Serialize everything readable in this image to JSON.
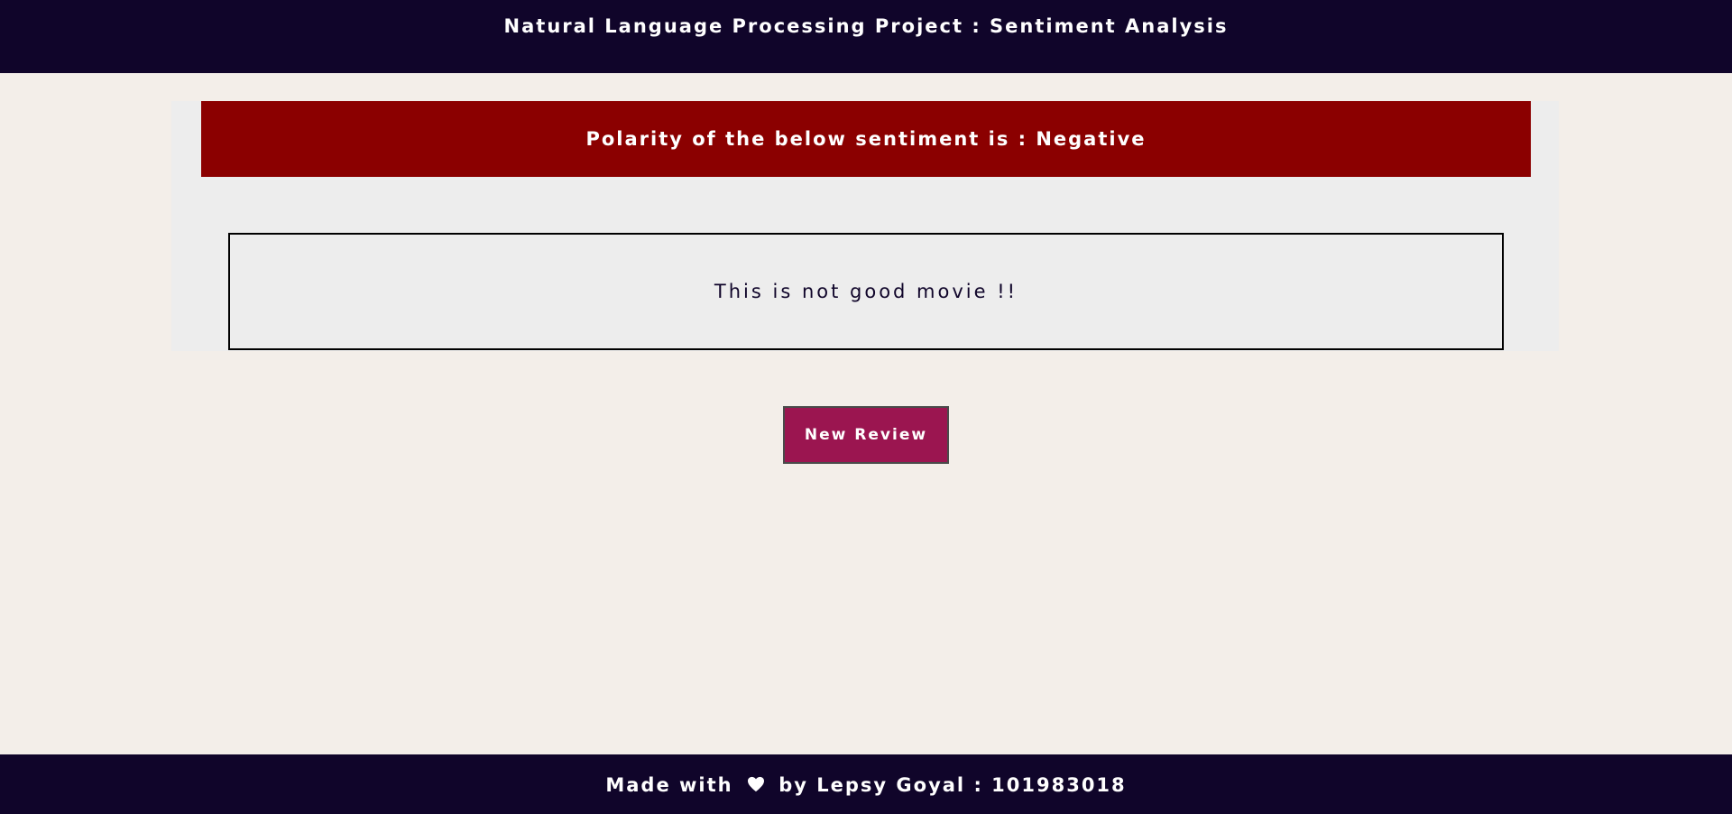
{
  "header": {
    "title": "Natural Language Processing Project : Sentiment Analysis"
  },
  "result": {
    "banner_text": "Polarity of the below sentiment is : Negative",
    "review_text": "This is not good movie !!"
  },
  "actions": {
    "new_review_label": "New Review"
  },
  "footer": {
    "prefix": "Made with",
    "icon": "heart-icon",
    "suffix": "by Lepsy Goyal : 101983018"
  },
  "colors": {
    "header_bg": "#10052a",
    "page_bg": "#f3eee9",
    "card_bg": "#ededed",
    "negative_banner": "#8b0000",
    "button_bg": "#9b1550"
  }
}
